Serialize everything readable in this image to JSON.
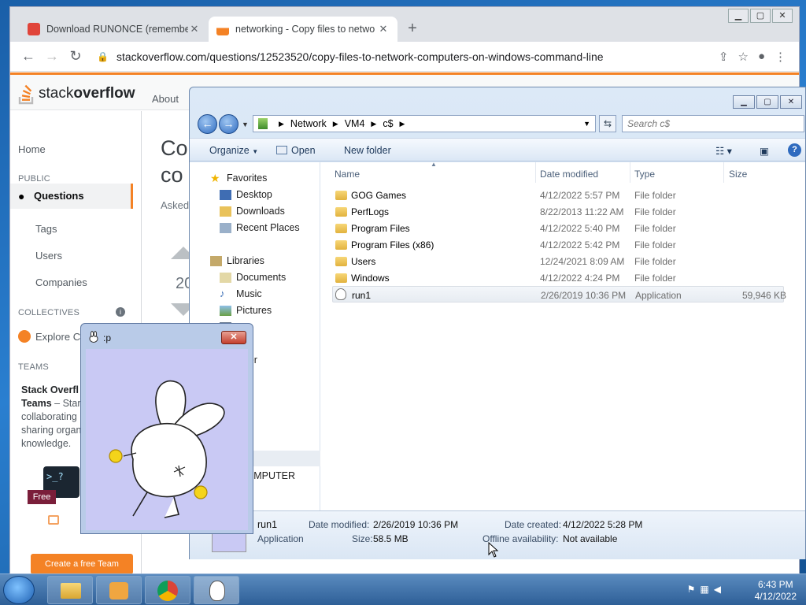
{
  "browser": {
    "tabs": [
      {
        "label": "Download RUNONCE (remember"
      },
      {
        "label": "networking - Copy files to netwo"
      }
    ],
    "url": "stackoverflow.com/questions/12523520/copy-files-to-network-computers-on-windows-command-line"
  },
  "so": {
    "logo_light": "stack",
    "logo_bold": "overflow",
    "about": "About",
    "nav": {
      "home": "Home",
      "public": "PUBLIC",
      "questions": "Questions",
      "tags": "Tags",
      "users": "Users",
      "companies": "Companies",
      "collectives": "COLLECTIVES",
      "explore": "Explore Co",
      "teams": "TEAMS"
    },
    "question": {
      "title1": "Co",
      "title2": "co",
      "asked": "Asked",
      "votes": "20"
    },
    "teams_box": {
      "title": "Stack Overfl",
      "title2": "Teams",
      "text1": " – Star",
      "text2": "collaborating",
      "text3": "sharing organ",
      "text4": "knowledge."
    },
    "promo_badge": "Free",
    "promo_prompt": ">_?",
    "create_team": "Create a free Team"
  },
  "explorer": {
    "breadcrumb": [
      "Network",
      "VM4",
      "c$"
    ],
    "search_placeholder": "Search c$",
    "commands": {
      "organize": "Organize",
      "open": "Open",
      "new_folder": "New folder"
    },
    "navpane": {
      "favorites": "Favorites",
      "desktop": "Desktop",
      "downloads": "Downloads",
      "recent": "Recent Places",
      "libraries": "Libraries",
      "documents": "Documents",
      "music": "Music",
      "pictures": "Pictures",
      "videos": "eos",
      "computer": "mputer",
      "network": "ork",
      "net_computer": "-KOMPUTER"
    },
    "columns": {
      "name": "Name",
      "date": "Date modified",
      "type": "Type",
      "size": "Size"
    },
    "files": [
      {
        "name": "GOG Games",
        "date": "4/12/2022 5:57 PM",
        "type": "File folder",
        "size": ""
      },
      {
        "name": "PerfLogs",
        "date": "8/22/2013 11:22 AM",
        "type": "File folder",
        "size": ""
      },
      {
        "name": "Program Files",
        "date": "4/12/2022 5:40 PM",
        "type": "File folder",
        "size": ""
      },
      {
        "name": "Program Files (x86)",
        "date": "4/12/2022 5:42 PM",
        "type": "File folder",
        "size": ""
      },
      {
        "name": "Users",
        "date": "12/24/2021 8:09 AM",
        "type": "File folder",
        "size": ""
      },
      {
        "name": "Windows",
        "date": "4/12/2022 4:24 PM",
        "type": "File folder",
        "size": ""
      },
      {
        "name": "run1",
        "date": "2/26/2019 10:36 PM",
        "type": "Application",
        "size": "59,946 KB"
      }
    ],
    "details": {
      "name": "run1",
      "type": "Application",
      "modified_label": "Date modified:",
      "modified": "2/26/2019 10:36 PM",
      "size_label": "Size:",
      "size": "58.5 MB",
      "created_label": "Date created:",
      "created": "4/12/2022 5:28 PM",
      "offline_label": "Offline availability:",
      "offline": "Not available"
    }
  },
  "popup": {
    "title": ":p"
  },
  "taskbar": {
    "time": "6:43 PM",
    "date": "4/12/2022"
  }
}
